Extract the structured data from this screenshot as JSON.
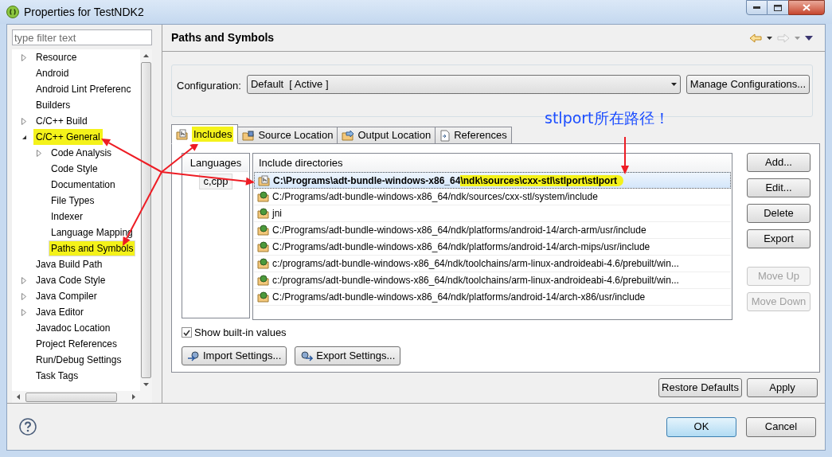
{
  "window": {
    "title": "Properties for TestNDK2"
  },
  "filter": {
    "placeholder": "type filter text"
  },
  "tree": [
    {
      "label": "Resource",
      "kind": "group",
      "expanded": false,
      "selected": false,
      "highlighted": false
    },
    {
      "label": "Android",
      "kind": "page",
      "selected": false,
      "highlighted": false
    },
    {
      "label": "Android Lint Preferenc",
      "kind": "page",
      "selected": false,
      "highlighted": false
    },
    {
      "label": "Builders",
      "kind": "page",
      "selected": false,
      "highlighted": false
    },
    {
      "label": "C/C++ Build",
      "kind": "group",
      "expanded": false,
      "selected": false,
      "highlighted": false
    },
    {
      "label": "C/C++ General",
      "kind": "group",
      "expanded": true,
      "selected": false,
      "highlighted": true,
      "children": [
        {
          "label": "Code Analysis",
          "kind": "group",
          "expanded": false,
          "selected": false,
          "highlighted": false
        },
        {
          "label": "Code Style",
          "kind": "page",
          "selected": false,
          "highlighted": false
        },
        {
          "label": "Documentation",
          "kind": "page",
          "selected": false,
          "highlighted": false
        },
        {
          "label": "File Types",
          "kind": "page",
          "selected": false,
          "highlighted": false
        },
        {
          "label": "Indexer",
          "kind": "page",
          "selected": false,
          "highlighted": false
        },
        {
          "label": "Language Mapping",
          "kind": "page",
          "selected": false,
          "highlighted": false
        },
        {
          "label": "Paths and Symbols",
          "kind": "page",
          "selected": true,
          "highlighted": true
        }
      ]
    },
    {
      "label": "Java Build Path",
      "kind": "page",
      "selected": false,
      "highlighted": false
    },
    {
      "label": "Java Code Style",
      "kind": "group",
      "expanded": false,
      "selected": false,
      "highlighted": false
    },
    {
      "label": "Java Compiler",
      "kind": "group",
      "expanded": false,
      "selected": false,
      "highlighted": false
    },
    {
      "label": "Java Editor",
      "kind": "group",
      "expanded": false,
      "selected": false,
      "highlighted": false
    },
    {
      "label": "Javadoc Location",
      "kind": "page",
      "selected": false,
      "highlighted": false
    },
    {
      "label": "Project References",
      "kind": "page",
      "selected": false,
      "highlighted": false
    },
    {
      "label": "Run/Debug Settings",
      "kind": "page",
      "selected": false,
      "highlighted": false
    },
    {
      "label": "Task Tags",
      "kind": "page",
      "selected": false,
      "highlighted": false
    }
  ],
  "page": {
    "title": "Paths and Symbols"
  },
  "configuration": {
    "label": "Configuration:",
    "value": "Default  [ Active ]",
    "button": "Manage Configurations..."
  },
  "annotation": {
    "text": "stlport所在路径！"
  },
  "tabs": [
    {
      "label": "Includes",
      "kind": "includes",
      "selected": true,
      "highlighted": true
    },
    {
      "label": "Source Location",
      "kind": "source",
      "selected": false,
      "highlighted": false
    },
    {
      "label": "Output Location",
      "kind": "output",
      "selected": false,
      "highlighted": false
    },
    {
      "label": "References",
      "kind": "references",
      "selected": false,
      "highlighted": false
    }
  ],
  "languages": {
    "header": "Languages",
    "items": [
      {
        "label": "c,cpp",
        "selected": true
      }
    ]
  },
  "includes": {
    "header": "Include directories",
    "rows": [
      {
        "text": "C:\\Programs\\adt-bundle-windows-x86_64",
        "highlight": "\\ndk\\sources\\cxx-stl\\stlport\\stlport",
        "kind": "user",
        "selected": true
      },
      {
        "text": "C:/Programs/adt-bundle-windows-x86_64/ndk/sources/cxx-stl/system/include",
        "kind": "builtin",
        "selected": false
      },
      {
        "text": "jni",
        "kind": "builtin",
        "selected": false
      },
      {
        "text": "C:/Programs/adt-bundle-windows-x86_64/ndk/platforms/android-14/arch-arm/usr/include",
        "kind": "builtin",
        "selected": false
      },
      {
        "text": "C:/Programs/adt-bundle-windows-x86_64/ndk/platforms/android-14/arch-mips/usr/include",
        "kind": "builtin",
        "selected": false
      },
      {
        "text": "c:/programs/adt-bundle-windows-x86_64/ndk/toolchains/arm-linux-androideabi-4.6/prebuilt/win...",
        "kind": "builtin",
        "selected": false
      },
      {
        "text": "c:/programs/adt-bundle-windows-x86_64/ndk/toolchains/arm-linux-androideabi-4.6/prebuilt/win...",
        "kind": "builtin",
        "selected": false
      },
      {
        "text": "C:/Programs/adt-bundle-windows-x86_64/ndk/platforms/android-14/arch-x86/usr/include",
        "kind": "builtin",
        "selected": false
      }
    ]
  },
  "side_buttons": [
    {
      "label": "Add...",
      "disabled": false
    },
    {
      "label": "Edit...",
      "disabled": false
    },
    {
      "label": "Delete",
      "disabled": false
    },
    {
      "label": "Export",
      "disabled": false
    },
    {
      "label": "Move Up",
      "disabled": true
    },
    {
      "label": "Move Down",
      "disabled": true
    }
  ],
  "show_builtin": {
    "label": "Show built-in values",
    "checked": true
  },
  "settings_buttons": [
    {
      "label": "Import Settings...",
      "kind": "import"
    },
    {
      "label": "Export Settings...",
      "kind": "export"
    }
  ],
  "page_buttons": [
    "Restore Defaults",
    "Apply"
  ],
  "dialog_buttons": [
    {
      "label": "OK",
      "default": true
    },
    {
      "label": "Cancel",
      "default": false
    }
  ]
}
